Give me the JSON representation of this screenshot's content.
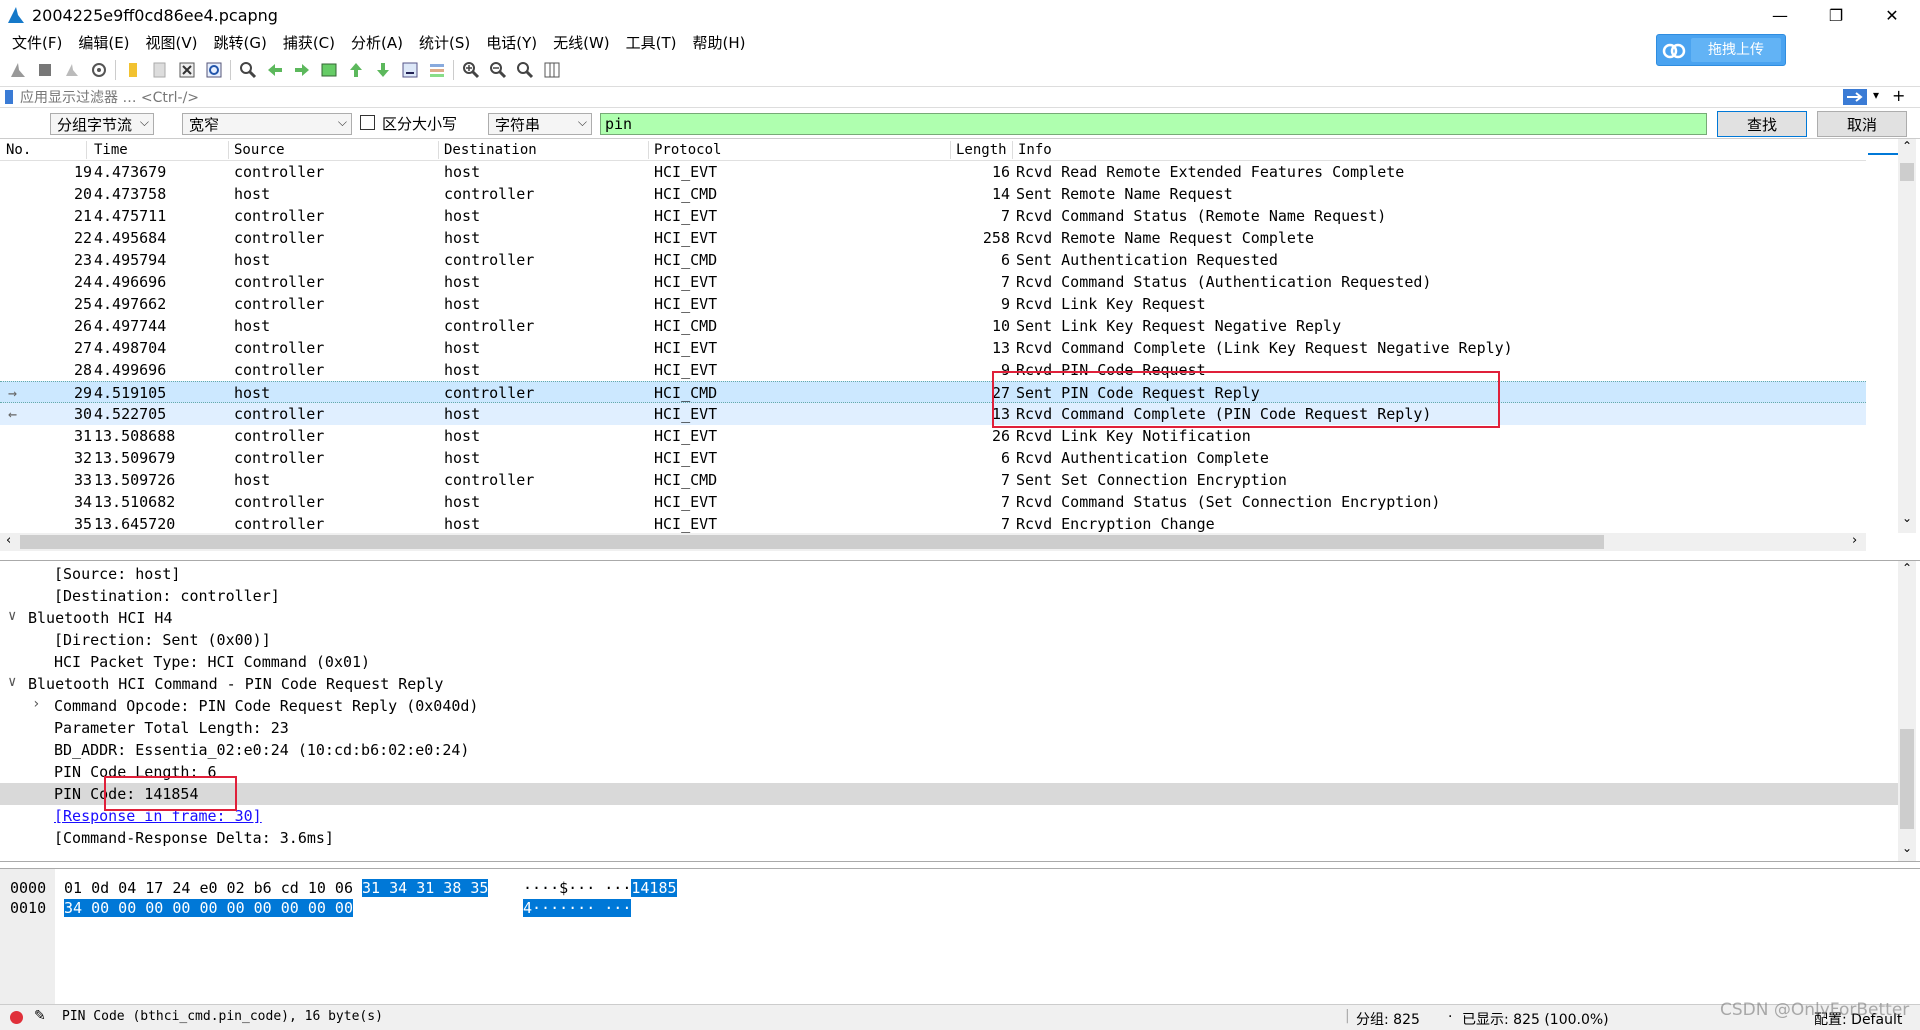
{
  "window": {
    "title": "2004225e9ff0cd86ee4.pcapng",
    "minimize": "—",
    "maximize": "❐",
    "close": "✕"
  },
  "menu": [
    "文件(F)",
    "编辑(E)",
    "视图(V)",
    "跳转(G)",
    "捕获(C)",
    "分析(A)",
    "统计(S)",
    "电话(Y)",
    "无线(W)",
    "工具(T)",
    "帮助(H)"
  ],
  "upload_label": "拖拽上传",
  "filter": {
    "placeholder": "应用显示过滤器 … <Ctrl-/>"
  },
  "find": {
    "search_in": "分组字节流",
    "char_width": "宽窄",
    "case_label": "区分大小写",
    "search_type": "字符串",
    "query": "pin",
    "find_button": "查找",
    "cancel_button": "取消"
  },
  "columns": {
    "no": "No.",
    "time": "Time",
    "source": "Source",
    "destination": "Destination",
    "protocol": "Protocol",
    "length": "Length",
    "info": "Info"
  },
  "packets": [
    {
      "no": "19",
      "time": "4.473679",
      "src": "controller",
      "dst": "host",
      "proto": "HCI_EVT",
      "len": "16",
      "info": "Rcvd Read Remote Extended Features Complete"
    },
    {
      "no": "20",
      "time": "4.473758",
      "src": "host",
      "dst": "controller",
      "proto": "HCI_CMD",
      "len": "14",
      "info": "Sent Remote Name Request"
    },
    {
      "no": "21",
      "time": "4.475711",
      "src": "controller",
      "dst": "host",
      "proto": "HCI_EVT",
      "len": "7",
      "info": "Rcvd Command Status (Remote Name Request)"
    },
    {
      "no": "22",
      "time": "4.495684",
      "src": "controller",
      "dst": "host",
      "proto": "HCI_EVT",
      "len": "258",
      "info": "Rcvd Remote Name Request Complete"
    },
    {
      "no": "23",
      "time": "4.495794",
      "src": "host",
      "dst": "controller",
      "proto": "HCI_CMD",
      "len": "6",
      "info": "Sent Authentication Requested"
    },
    {
      "no": "24",
      "time": "4.496696",
      "src": "controller",
      "dst": "host",
      "proto": "HCI_EVT",
      "len": "7",
      "info": "Rcvd Command Status (Authentication Requested)"
    },
    {
      "no": "25",
      "time": "4.497662",
      "src": "controller",
      "dst": "host",
      "proto": "HCI_EVT",
      "len": "9",
      "info": "Rcvd Link Key Request"
    },
    {
      "no": "26",
      "time": "4.497744",
      "src": "host",
      "dst": "controller",
      "proto": "HCI_CMD",
      "len": "10",
      "info": "Sent Link Key Request Negative Reply"
    },
    {
      "no": "27",
      "time": "4.498704",
      "src": "controller",
      "dst": "host",
      "proto": "HCI_EVT",
      "len": "13",
      "info": "Rcvd Command Complete (Link Key Request Negative Reply)"
    },
    {
      "no": "28",
      "time": "4.499696",
      "src": "controller",
      "dst": "host",
      "proto": "HCI_EVT",
      "len": "9",
      "info": "Rcvd PIN Code Request"
    },
    {
      "no": "29",
      "time": "4.519105",
      "src": "host",
      "dst": "controller",
      "proto": "HCI_CMD",
      "len": "27",
      "info": "Sent PIN Code Request Reply",
      "marker": "→"
    },
    {
      "no": "30",
      "time": "4.522705",
      "src": "controller",
      "dst": "host",
      "proto": "HCI_EVT",
      "len": "13",
      "info": "Rcvd Command Complete (PIN Code Request Reply)",
      "marker": "←"
    },
    {
      "no": "31",
      "time": "13.508688",
      "src": "controller",
      "dst": "host",
      "proto": "HCI_EVT",
      "len": "26",
      "info": "Rcvd Link Key Notification"
    },
    {
      "no": "32",
      "time": "13.509679",
      "src": "controller",
      "dst": "host",
      "proto": "HCI_EVT",
      "len": "6",
      "info": "Rcvd Authentication Complete"
    },
    {
      "no": "33",
      "time": "13.509726",
      "src": "host",
      "dst": "controller",
      "proto": "HCI_CMD",
      "len": "7",
      "info": "Sent Set Connection Encryption"
    },
    {
      "no": "34",
      "time": "13.510682",
      "src": "controller",
      "dst": "host",
      "proto": "HCI_EVT",
      "len": "7",
      "info": "Rcvd Command Status (Set Connection Encryption)"
    },
    {
      "no": "35",
      "time": "13.645720",
      "src": "controller",
      "dst": "host",
      "proto": "HCI_EVT",
      "len": "7",
      "info": "Rcvd Encryption Change"
    }
  ],
  "details": [
    {
      "text": "[Source: host]"
    },
    {
      "text": "[Destination: controller]"
    },
    {
      "text": "Bluetooth HCI H4",
      "toggle": "∨"
    },
    {
      "text": "[Direction: Sent (0x00)]"
    },
    {
      "text": "HCI Packet Type: HCI Command (0x01)"
    },
    {
      "text": "Bluetooth HCI Command - PIN Code Request Reply",
      "toggle": "∨"
    },
    {
      "text": "Command Opcode: PIN Code Request Reply (0x040d)",
      "toggle": "›"
    },
    {
      "text": "Parameter Total Length: 23"
    },
    {
      "text": "BD_ADDR: Essentia_02:e0:24 (10:cd:b6:02:e0:24)"
    },
    {
      "text": "PIN Code Length: 6"
    },
    {
      "text": "PIN Code: 141854"
    },
    {
      "text": "[Response in frame: 30]"
    },
    {
      "text": "[Command-Response Delta: 3.6ms]"
    }
  ],
  "hex": [
    {
      "offset": "0000",
      "plain": "01 0d 04 17 24 e0 02 b6  cd 10 06",
      "sel": "31 34 31 38 35",
      "ascii_plain": "····$··· ···",
      "ascii_sel": "14185"
    },
    {
      "offset": "0010",
      "plain": "",
      "sel": "34 00 00 00 00 00 00 00  00 00 00",
      "ascii_plain": "",
      "ascii_sel": "4······· ···"
    }
  ],
  "status": {
    "field": "PIN Code (bthci_cmd.pin_code), 16 byte(s)",
    "packets": "分组: 825",
    "displayed": "已显示: 825 (100.0%)",
    "profile": "配置: Default"
  },
  "watermark": "CSDN @OnlyForBetter",
  "colors": {
    "accent": "#0078d7",
    "find_input_bg": "#afffaf",
    "selected_row": "#cce8ff",
    "highlight_box": "#e0203a"
  }
}
